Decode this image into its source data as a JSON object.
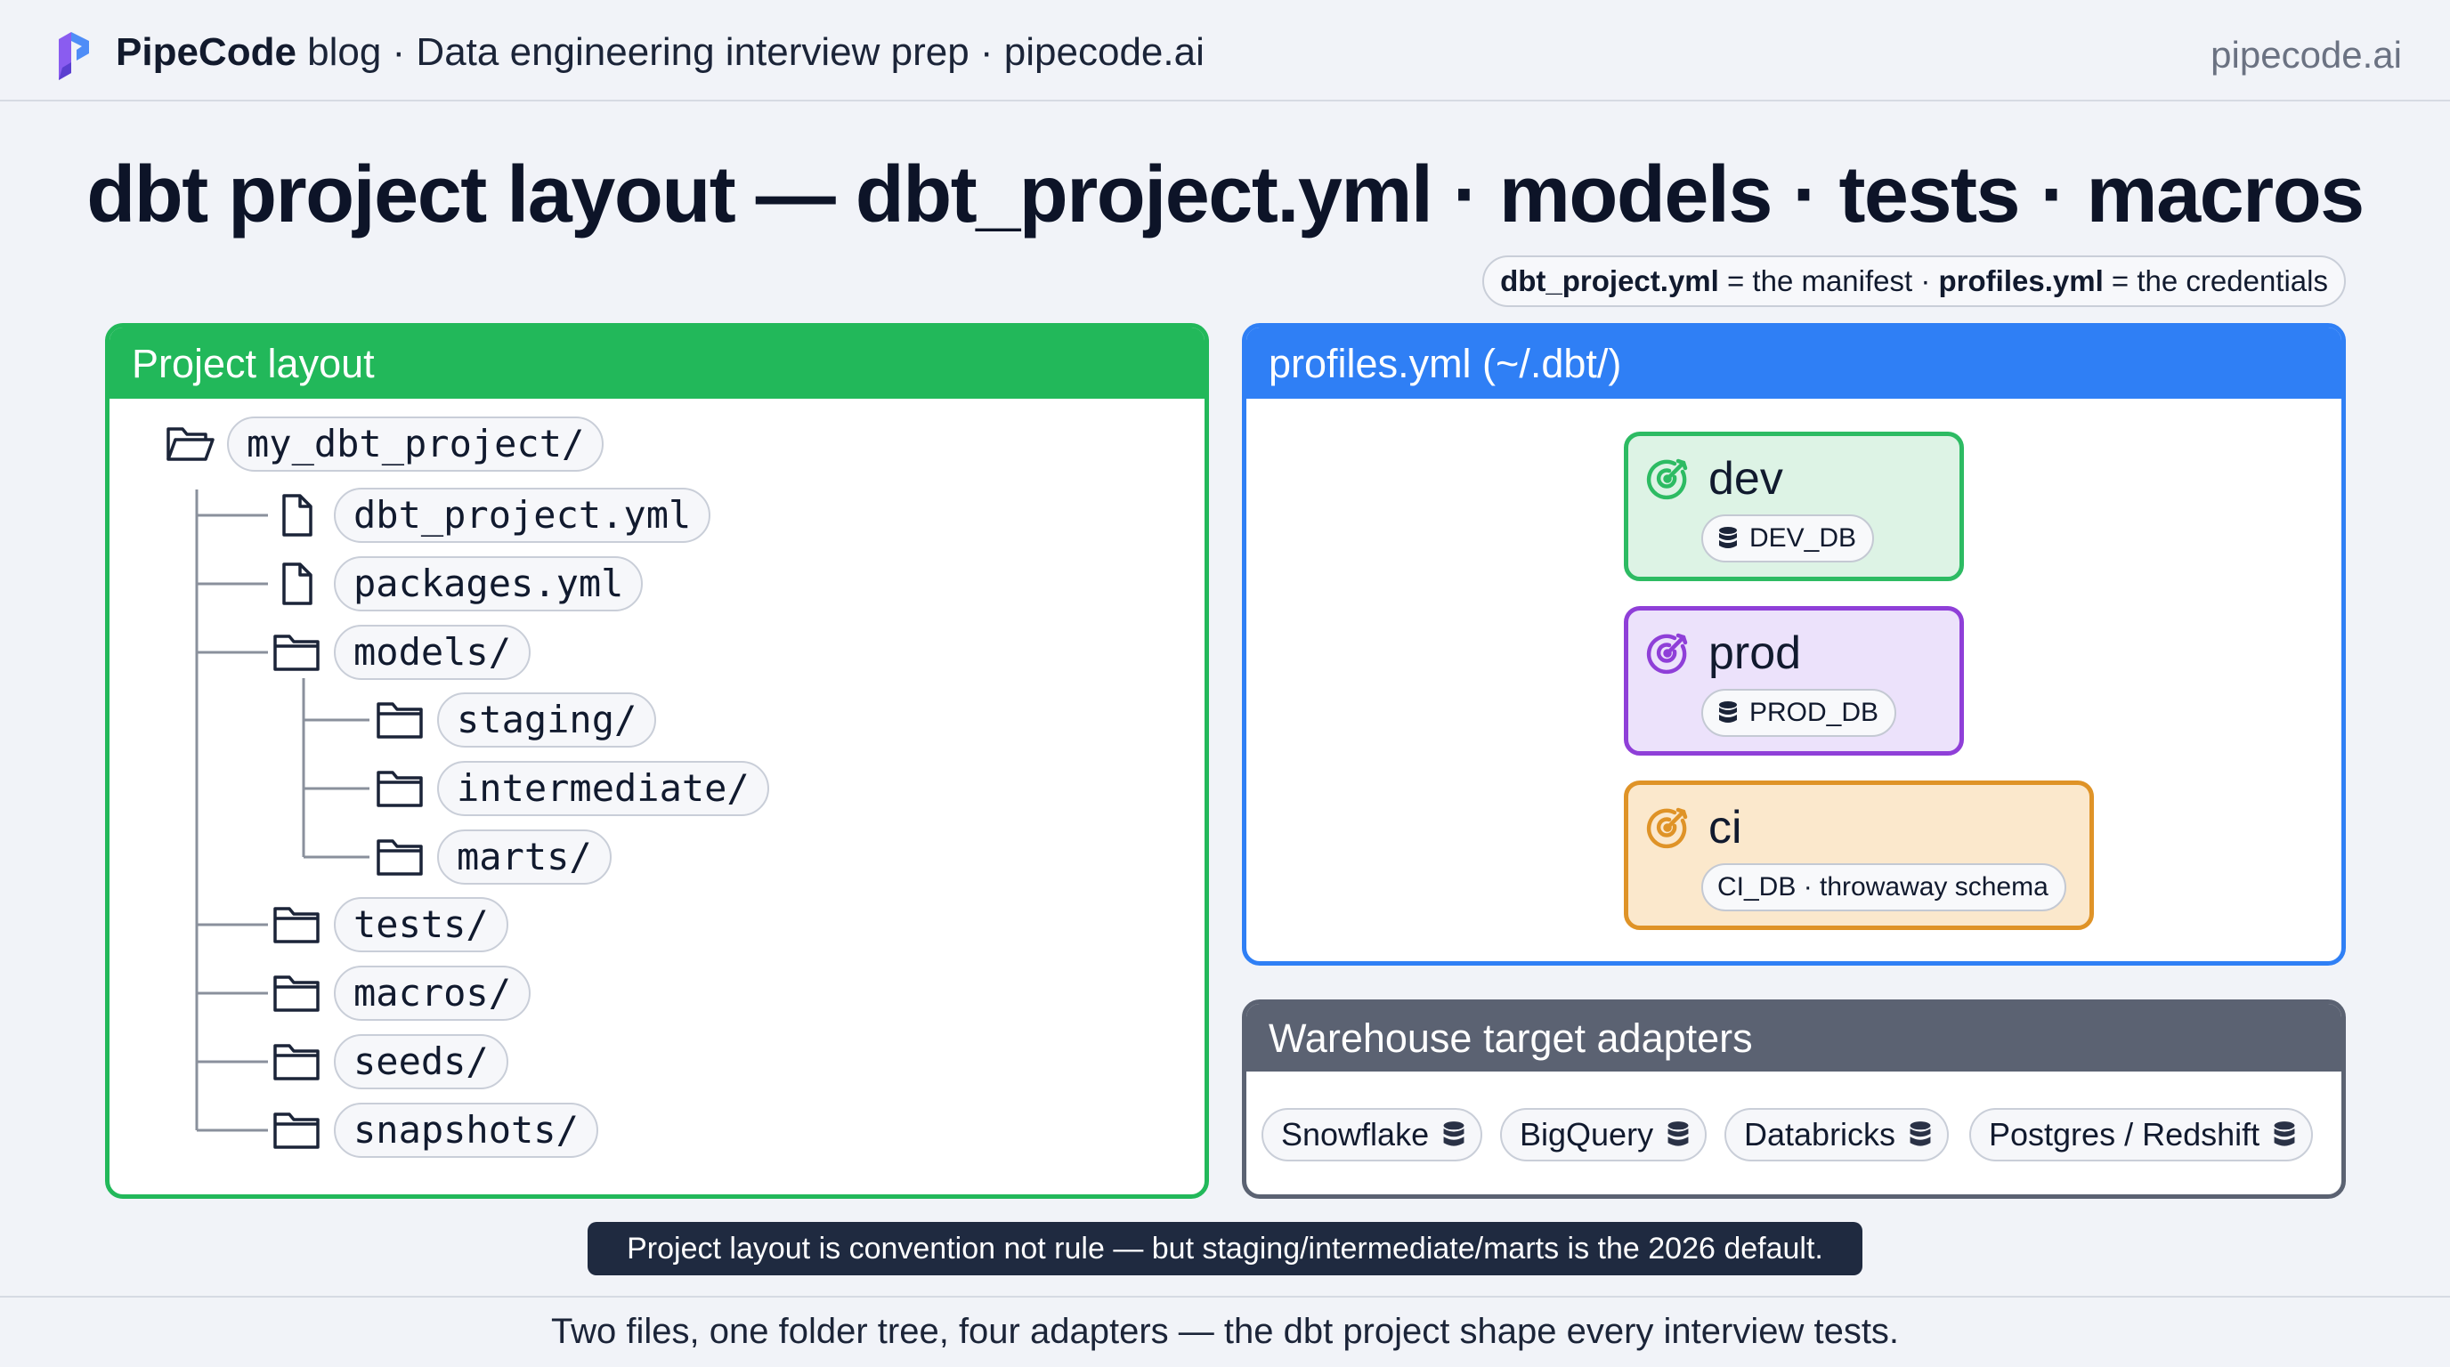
{
  "header": {
    "brand": "PipeCode",
    "tagline": " blog · Data engineering interview prep · pipecode.ai",
    "site": "pipecode.ai"
  },
  "title": "dbt project layout — dbt_project.yml · models · tests · macros",
  "note": {
    "file1": "dbt_project.yml",
    "text1": " = the manifest · ",
    "file2": "profiles.yml",
    "text2": " = the credentials"
  },
  "layout_panel": {
    "heading": "Project layout",
    "tree": [
      {
        "label": "my_dbt_project/",
        "kind": "folder-open-icon"
      },
      {
        "label": "dbt_project.yml",
        "kind": "file-icon"
      },
      {
        "label": "packages.yml",
        "kind": "file-icon"
      },
      {
        "label": "models/",
        "kind": "folder-icon"
      },
      {
        "label": "staging/",
        "kind": "folder-icon"
      },
      {
        "label": "intermediate/",
        "kind": "folder-icon"
      },
      {
        "label": "marts/",
        "kind": "folder-icon"
      },
      {
        "label": "tests/",
        "kind": "folder-icon"
      },
      {
        "label": "macros/",
        "kind": "folder-icon"
      },
      {
        "label": "seeds/",
        "kind": "folder-icon"
      },
      {
        "label": "snapshots/",
        "kind": "folder-icon"
      }
    ]
  },
  "profiles_panel": {
    "heading": "profiles.yml (~/.dbt/)",
    "targets": [
      {
        "name": "dev",
        "db": "DEV_DB",
        "color": "#2dbb63"
      },
      {
        "name": "prod",
        "db": "PROD_DB",
        "color": "#8f3fd8"
      },
      {
        "name": "ci",
        "db": "CI_DB · throwaway schema",
        "color": "#df9327"
      }
    ]
  },
  "adapters_panel": {
    "heading": "Warehouse target adapters",
    "adapters": [
      "Snowflake",
      "BigQuery",
      "Databricks",
      "Postgres / Redshift"
    ]
  },
  "callout": "Project layout is convention not rule — but staging/intermediate/marts is the 2026 default.",
  "caption": "Two files, one folder tree, four adapters — the dbt project shape every interview tests.",
  "colors": {
    "layout_accent": "#22b85a",
    "profiles_accent": "#2f7ff5",
    "adapters_accent": "#5b6272"
  }
}
